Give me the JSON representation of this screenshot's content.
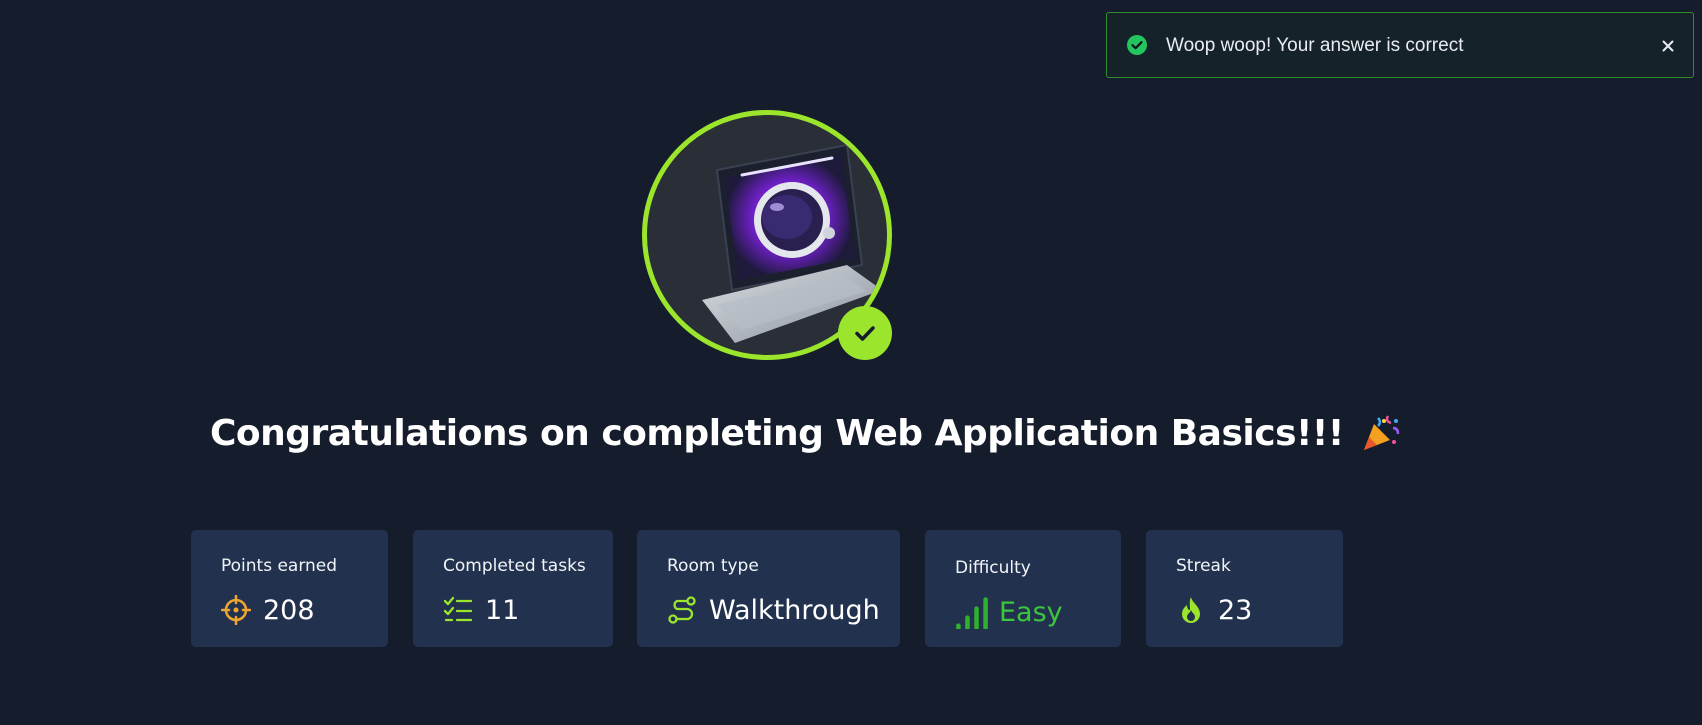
{
  "toast": {
    "message": "Woop woop! Your answer is correct",
    "status_color": "#22c55e",
    "icon": "check-circle-icon",
    "close_icon": "close-icon"
  },
  "badge": {
    "image": "laptop-astronaut-badge",
    "ring_color": "#9be52c",
    "check_icon": "check-icon"
  },
  "heading": {
    "title": "Congratulations on completing Web Application Basics!!!",
    "emoji_icon": "party-popper-icon"
  },
  "stats": {
    "points": {
      "label": "Points earned",
      "value": "208",
      "icon": "crosshair-icon"
    },
    "tasks": {
      "label": "Completed tasks",
      "value": "11",
      "icon": "checklist-icon"
    },
    "room_type": {
      "label": "Room type",
      "value": "Walkthrough",
      "icon": "route-icon"
    },
    "difficulty": {
      "label": "Difficulty",
      "value": "Easy",
      "icon": "signal-bars-icon",
      "color": "#3cc63c"
    },
    "streak": {
      "label": "Streak",
      "value": "23",
      "icon": "flame-icon"
    }
  }
}
